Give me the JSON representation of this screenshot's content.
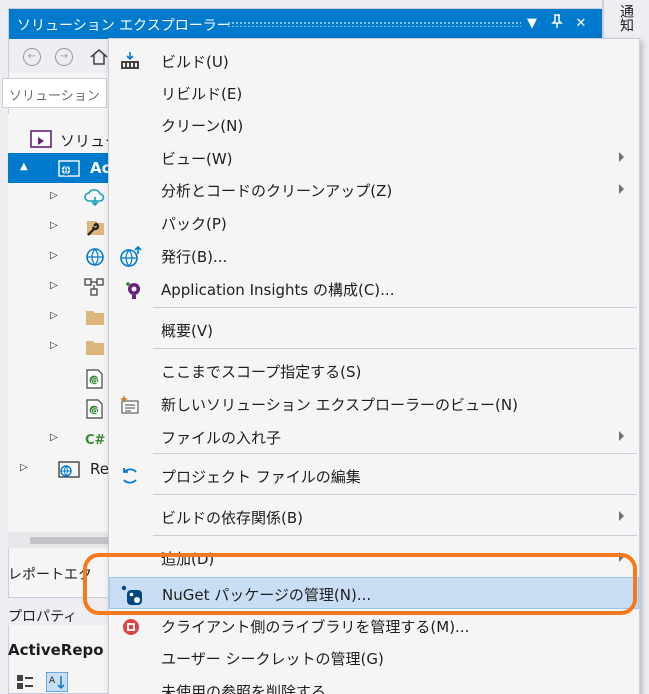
{
  "solution_explorer": {
    "title": "ソリューション エクスプローラー",
    "search_placeholder": "ソリューション",
    "tree": [
      {
        "label": "ソリュー",
        "icon": "solution-icon"
      },
      {
        "label": "Acti",
        "icon": "web-project-icon",
        "selected": true
      },
      {
        "label": "",
        "icon": "connected-services-icon"
      },
      {
        "label": "",
        "icon": "properties-icon"
      },
      {
        "label": "",
        "icon": "globe-icon"
      },
      {
        "label": "",
        "icon": "dependencies-icon"
      },
      {
        "label": "",
        "icon": "folder-icon"
      },
      {
        "label": "",
        "icon": "folder-icon"
      },
      {
        "label": "",
        "icon": "razor-file-icon"
      },
      {
        "label": "",
        "icon": "razor-file-icon"
      },
      {
        "label": "C#",
        "icon": "csharp-file-icon"
      },
      {
        "label": "Re",
        "icon": "web-project-icon"
      }
    ],
    "report_tab": "レポートエク",
    "properties_title": "プロパティ",
    "properties_object": "ActiveRepo"
  },
  "right_strip": {
    "notify_tab": "通知"
  },
  "context_menu": {
    "items": [
      {
        "label": "ビルド(U)",
        "icon": "build-icon",
        "submenu": false
      },
      {
        "label": "リビルド(E)",
        "icon": "",
        "submenu": false
      },
      {
        "label": "クリーン(N)",
        "icon": "",
        "submenu": false
      },
      {
        "label": "ビュー(W)",
        "icon": "",
        "submenu": true
      },
      {
        "label": "分析とコードのクリーンアップ(Z)",
        "icon": "",
        "submenu": true
      },
      {
        "label": "パック(P)",
        "icon": "",
        "submenu": false
      },
      {
        "label": "発行(B)...",
        "icon": "publish-icon",
        "submenu": false
      },
      {
        "label": "Application Insights の構成(C)...",
        "icon": "application-insights-icon",
        "submenu": false
      },
      {
        "label": "概要(V)",
        "icon": "",
        "submenu": false
      },
      {
        "label": "ここまでスコープ指定する(S)",
        "icon": "",
        "submenu": false
      },
      {
        "label": "新しいソリューション エクスプローラーのビュー(N)",
        "icon": "new-view-icon",
        "submenu": false
      },
      {
        "label": "ファイルの入れ子",
        "icon": "",
        "submenu": true
      },
      {
        "label": "プロジェクト ファイルの編集",
        "icon": "edit-project-icon",
        "submenu": false
      },
      {
        "label": "ビルドの依存関係(B)",
        "icon": "",
        "submenu": true
      },
      {
        "label": "追加(D)",
        "icon": "",
        "submenu": true
      },
      {
        "label": "NuGet パッケージの管理(N)...",
        "icon": "nuget-icon",
        "submenu": false,
        "highlighted": true
      },
      {
        "label": "クライアント側のライブラリを管理する(M)...",
        "icon": "library-icon",
        "submenu": false
      },
      {
        "label": "ユーザー シークレットの管理(G)",
        "icon": "",
        "submenu": false
      },
      {
        "label": "未使用の参照を削除する",
        "icon": "",
        "submenu": false
      }
    ]
  },
  "colors": {
    "accent": "#007acc",
    "highlight_ring": "#f5791d",
    "menu_hover": "#c9def5"
  }
}
